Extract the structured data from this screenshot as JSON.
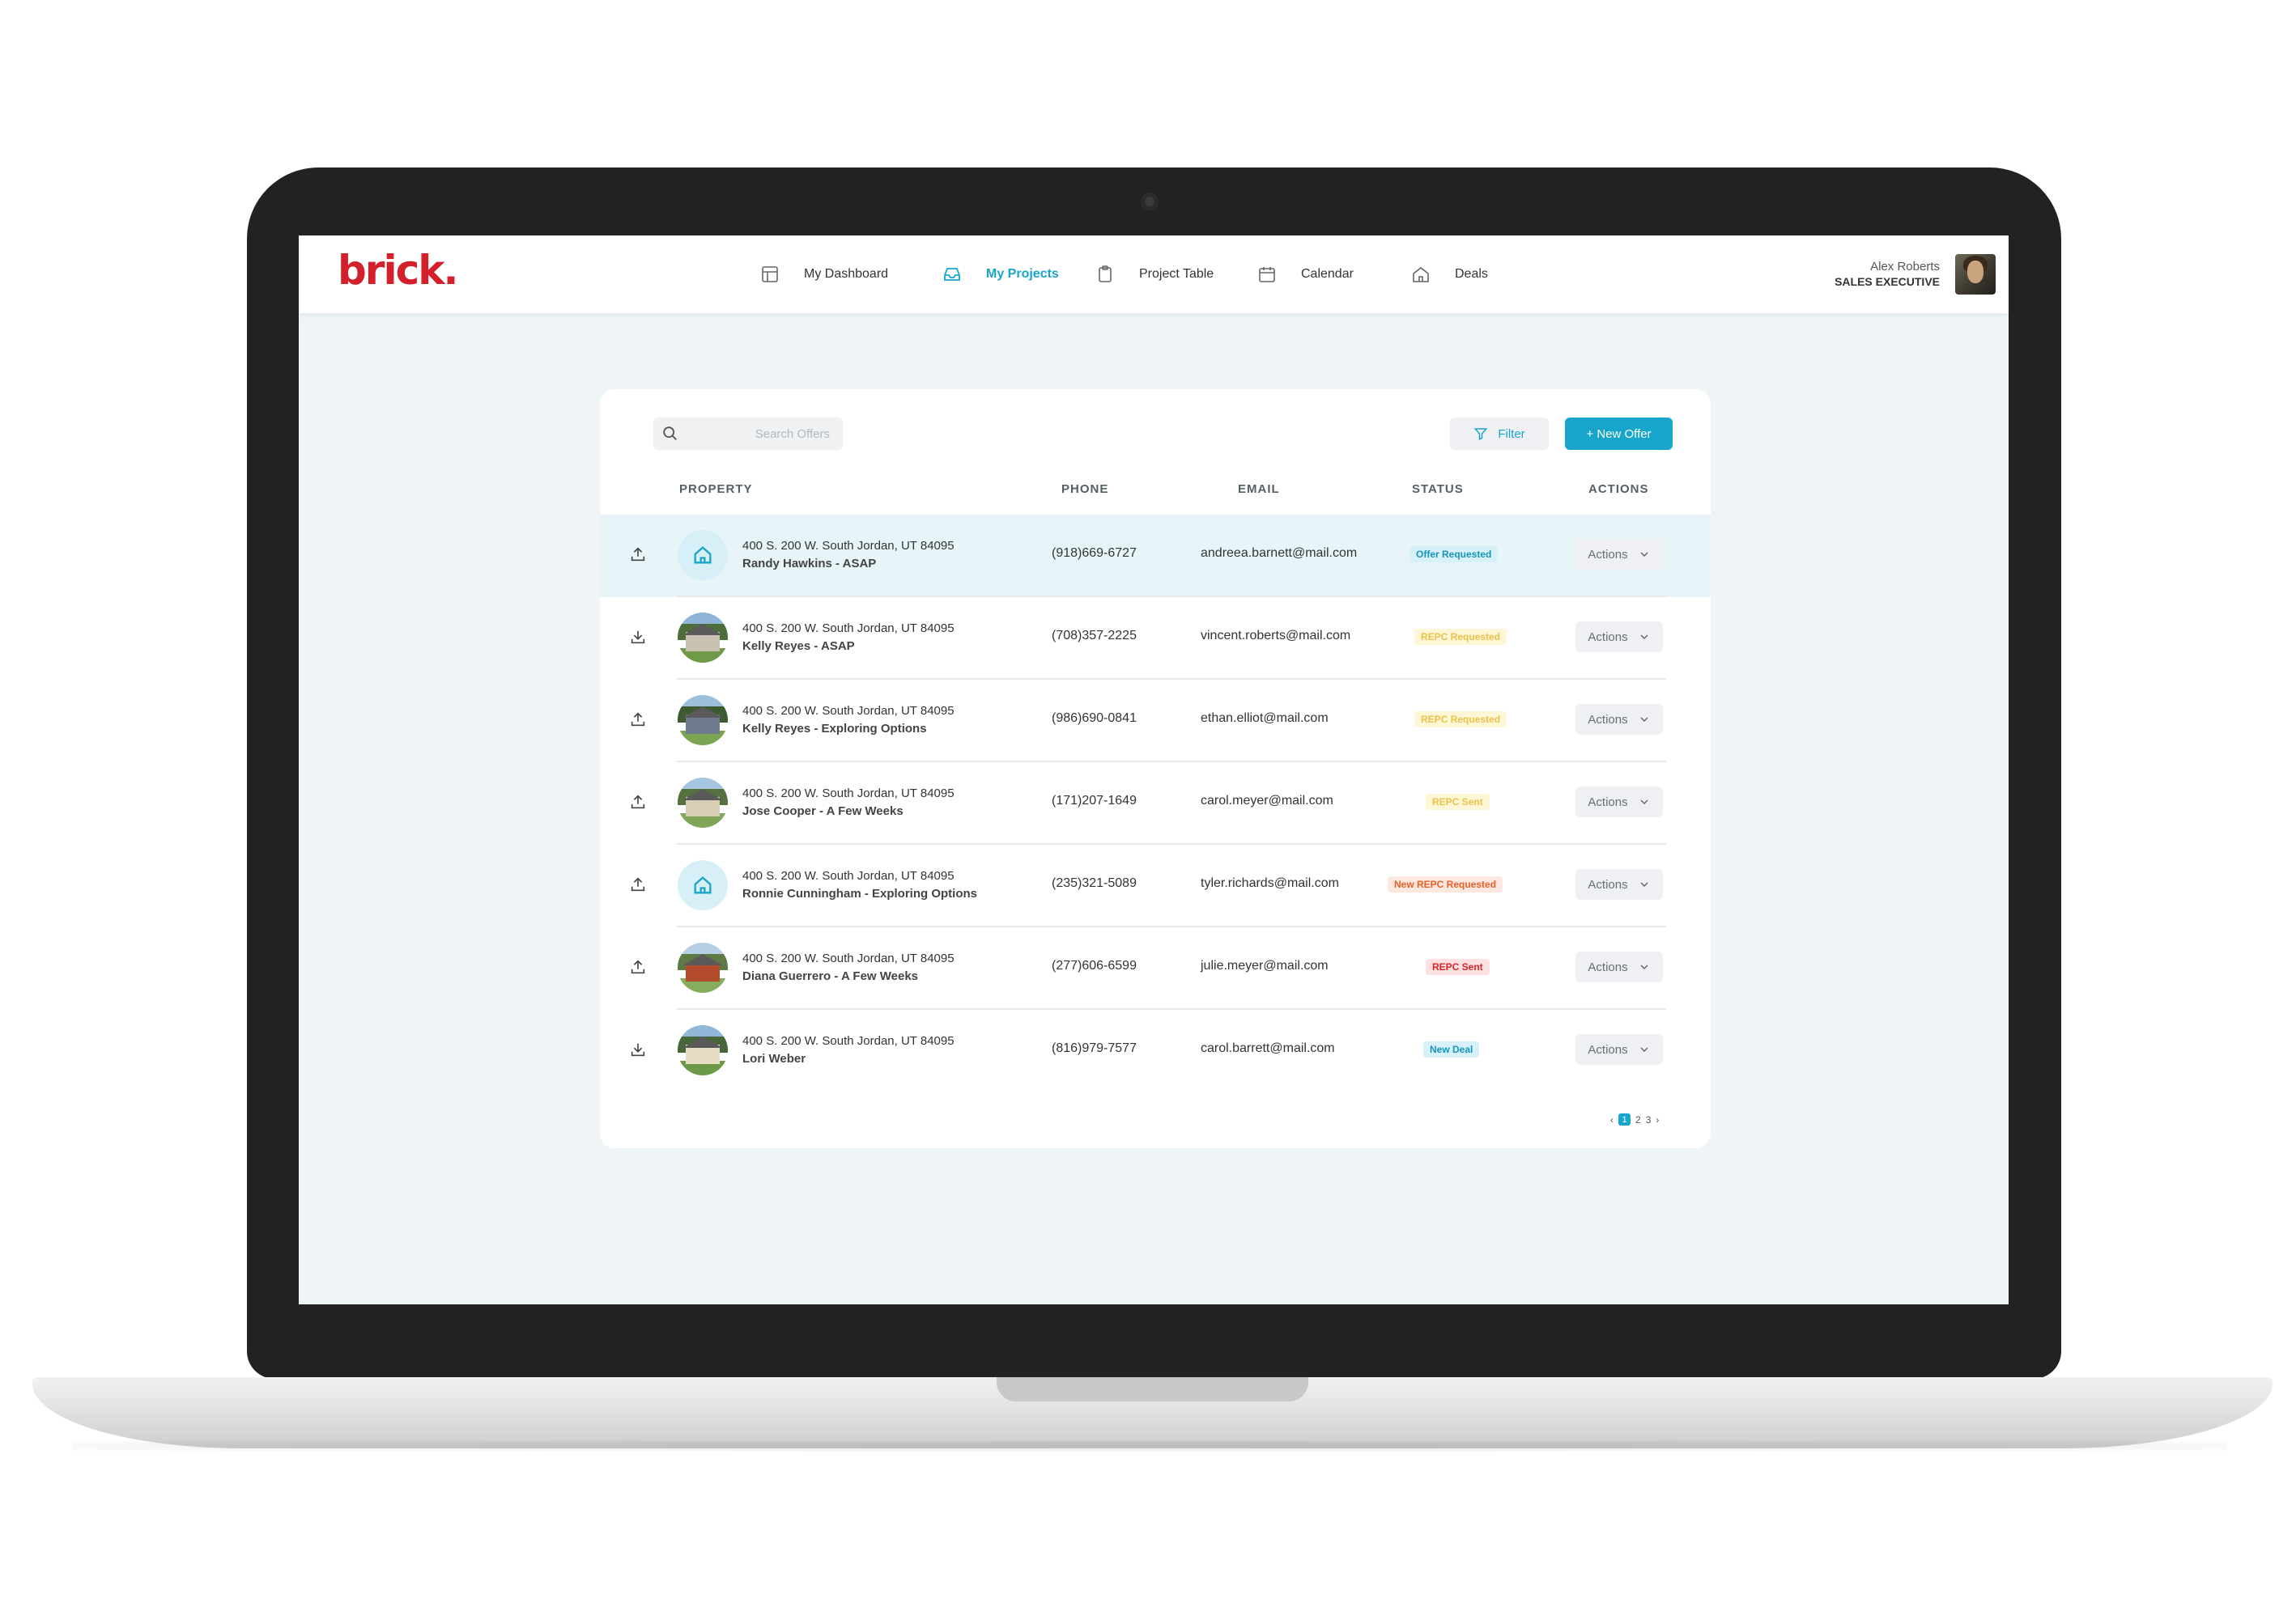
{
  "app": {
    "logo": "brick.",
    "nav": [
      {
        "label": "My Dashboard",
        "icon": "dashboard-icon",
        "active": false
      },
      {
        "label": "My Projects",
        "icon": "inbox-icon",
        "active": true
      },
      {
        "label": "Project Table",
        "icon": "clipboard-icon",
        "active": false
      },
      {
        "label": "Calendar",
        "icon": "calendar-icon",
        "active": false
      },
      {
        "label": "Deals",
        "icon": "home-icon",
        "active": false
      }
    ],
    "user": {
      "name": "Alex Roberts",
      "role": "SALES EXECUTIVE"
    }
  },
  "toolbar": {
    "search_placeholder": "Search Offers",
    "filter_label": "Filter",
    "new_offer_label": "+ New Offer"
  },
  "table": {
    "headers": {
      "property": "PROPERTY",
      "phone": "PHONE",
      "email": "EMAIL",
      "status": "STATUS",
      "actions": "ACTIONS"
    },
    "action_label": "Actions",
    "rows": [
      {
        "icon": "upload-icon",
        "thumb": "placeholder",
        "address": "400 S. 200 W. South Jordan, UT 84095",
        "owner": "Randy Hawkins - ASAP",
        "phone": "(918)669-6727",
        "email": "andreea.barnett@mail.com",
        "status": "Offer Requested",
        "status_style": "blue"
      },
      {
        "icon": "download-icon",
        "thumb": "photo",
        "address": "400 S. 200 W. South Jordan, UT 84095",
        "owner": "Kelly Reyes - ASAP",
        "phone": "(708)357-2225",
        "email": "vincent.roberts@mail.com",
        "status": "REPC Requested",
        "status_style": "yellow"
      },
      {
        "icon": "upload-icon",
        "thumb": "photo",
        "address": "400 S. 200 W. South Jordan, UT 84095",
        "owner": "Kelly Reyes - Exploring Options",
        "phone": "(986)690-0841",
        "email": "ethan.elliot@mail.com",
        "status": "REPC Requested",
        "status_style": "yellow"
      },
      {
        "icon": "upload-icon",
        "thumb": "photo",
        "address": "400 S. 200 W. South Jordan, UT 84095",
        "owner": "Jose Cooper - A Few Weeks",
        "phone": "(171)207-1649",
        "email": "carol.meyer@mail.com",
        "status": "REPC Sent",
        "status_style": "yellow"
      },
      {
        "icon": "upload-icon",
        "thumb": "placeholder",
        "address": "400 S. 200 W. South Jordan, UT 84095",
        "owner": "Ronnie Cunningham - Exploring Options",
        "phone": "(235)321-5089",
        "email": "tyler.richards@mail.com",
        "status": "New REPC Requested",
        "status_style": "orange"
      },
      {
        "icon": "upload-icon",
        "thumb": "photo",
        "address": "400 S. 200 W. South Jordan, UT 84095",
        "owner": "Diana Guerrero - A Few Weeks",
        "phone": "(277)606-6599",
        "email": "julie.meyer@mail.com",
        "status": "REPC Sent",
        "status_style": "red"
      },
      {
        "icon": "download-icon",
        "thumb": "photo",
        "address": "400 S. 200 W. South Jordan, UT 84095",
        "owner": "Lori Weber",
        "phone": "(816)979-7577",
        "email": "carol.barrett@mail.com",
        "status": "New Deal",
        "status_style": "blue"
      }
    ]
  },
  "pagination": {
    "prev": "‹",
    "pages": [
      "1",
      "2",
      "3"
    ],
    "current": "1",
    "next": "›"
  },
  "colors": {
    "accent": "#18a5cc",
    "brand": "#d4202a",
    "badge_blue_bg": "#d8f0f7",
    "badge_blue_fg": "#1495bb",
    "badge_yellow_bg": "#fff6d6",
    "badge_yellow_fg": "#e8c24a",
    "badge_orange_bg": "#fde8df",
    "badge_orange_fg": "#e85f28",
    "badge_red_bg": "#fde1e1",
    "badge_red_fg": "#d8252b"
  }
}
